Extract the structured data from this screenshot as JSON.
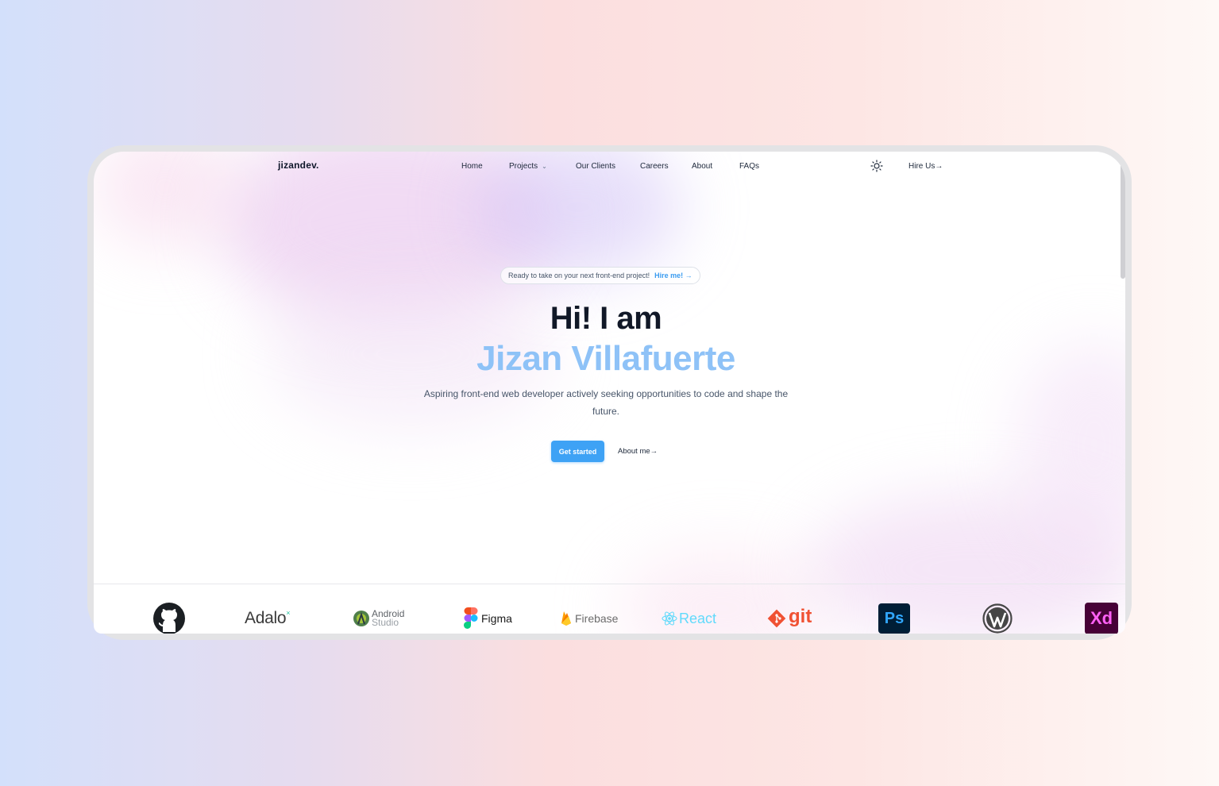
{
  "nav": {
    "logo": "jizandev.",
    "items": [
      {
        "label": "Home"
      },
      {
        "label": "Projects"
      },
      {
        "label": "Our Clients"
      },
      {
        "label": "Careers"
      },
      {
        "label": "About"
      },
      {
        "label": "FAQs"
      }
    ],
    "theme_icon": "sun-icon",
    "hire_label": "Hire Us→"
  },
  "hero": {
    "announcement_text": "Ready to take on your next front-end project!",
    "announcement_link": "Hire me! →",
    "heading_line1": "Hi! I am",
    "heading_line2": "Jizan Villafuerte",
    "subtitle": "Aspiring front-end web developer actively seeking opportunities to code and shape the future.",
    "primary_button": "Get started",
    "secondary_button": "About me→"
  },
  "logos": {
    "items": [
      {
        "icon": "github-logo"
      },
      {
        "icon": "adalo-logo",
        "text": "Adalo"
      },
      {
        "icon": "android-studio-logo",
        "text": "Android",
        "text2": "Studio"
      },
      {
        "icon": "figma-logo",
        "text": "Figma"
      },
      {
        "icon": "firebase-logo",
        "text": "Firebase"
      },
      {
        "icon": "react-logo",
        "text": "React"
      },
      {
        "icon": "git-logo",
        "text": "git"
      },
      {
        "icon": "photoshop-logo",
        "text": "Ps"
      },
      {
        "icon": "wordpress-logo"
      },
      {
        "icon": "adobe-xd-logo",
        "text": "Xd"
      }
    ]
  },
  "colors": {
    "accent": "#3ea2f5",
    "heading_highlight": "#8ec2f7",
    "text_dark": "#111827"
  }
}
